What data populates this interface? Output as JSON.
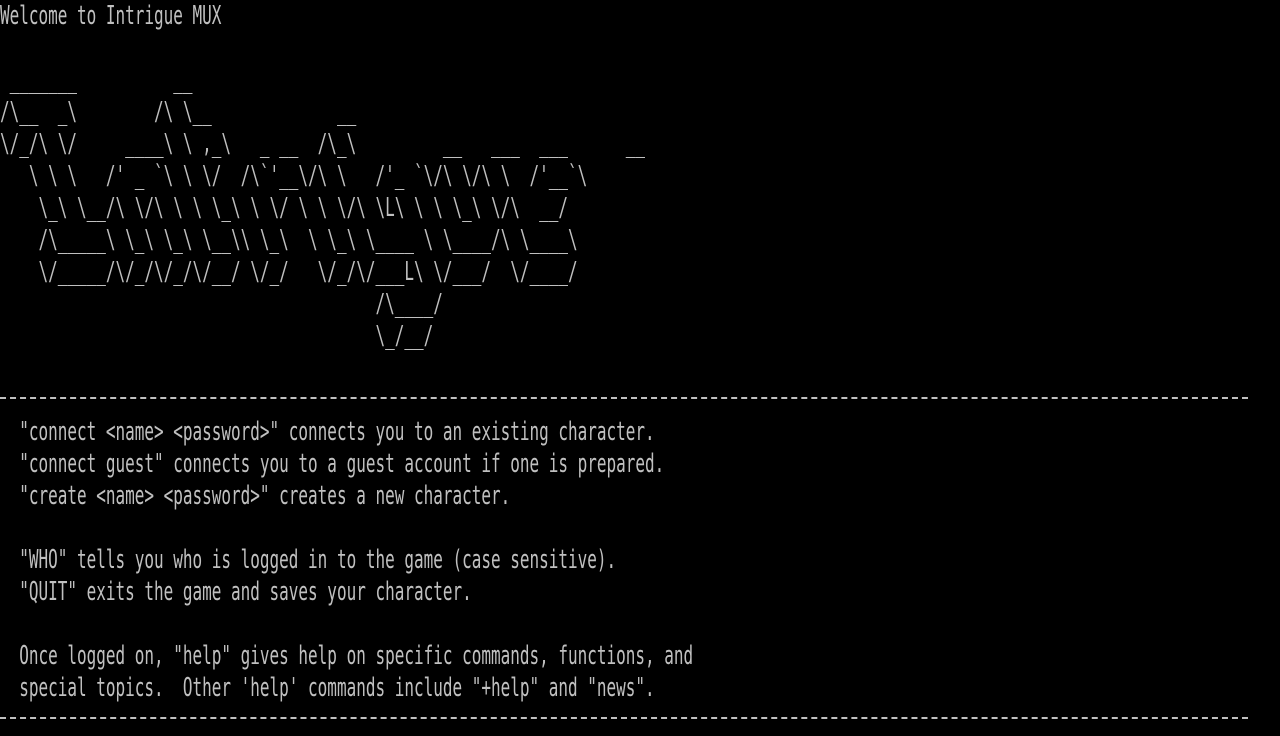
{
  "window": {
    "title": "Intrigue MUX",
    "fg_color": "#c0c0c0",
    "bg_color": "#000000"
  },
  "greeting": "Welcome to Intrigue MUX",
  "banner": {
    "lines": [
      " _______          __",
      "/\\__  _\\        /\\ \\__             __",
      "\\/_/\\ \\/     ____\\ \\ ,_\\   _ __  /\\_\\         __   ___  ___      __",
      "   \\ \\ \\   /' _ `\\ \\ \\/  /\\`'__\\/\\ \\   /'_ `\\/\\ \\/\\ \\  /'__`\\",
      "    \\_\\ \\__/\\ \\/\\ \\ \\ \\_\\ \\ \\/ \\ \\ \\/\\ \\L\\ \\ \\ \\_\\ \\/\\  __/",
      "    /\\_____\\ \\_\\ \\_\\ \\__\\\\ \\_\\  \\ \\_\\ \\____ \\ \\____/\\ \\____\\",
      "    \\/_____/\\/_/\\/_/\\/__/ \\/_/   \\/_/\\/___L\\ \\/___/  \\/____/",
      "                                       /\\____/",
      "                                       \\_/__/"
    ]
  },
  "instructions": [
    "  \"connect <name> <password>\" connects you to an existing character.",
    "  \"connect guest\" connects you to a guest account if one is prepared.",
    "  \"create <name> <password>\" creates a new character.",
    "",
    "  \"WHO\" tells you who is logged in to the game (case sensitive).",
    "  \"QUIT\" exits the game and saves your character.",
    "",
    "  Once logged on, \"help\" gives help on specific commands, functions, and",
    "  special topics.  Other 'help' commands include \"+help\" and \"news\"."
  ]
}
